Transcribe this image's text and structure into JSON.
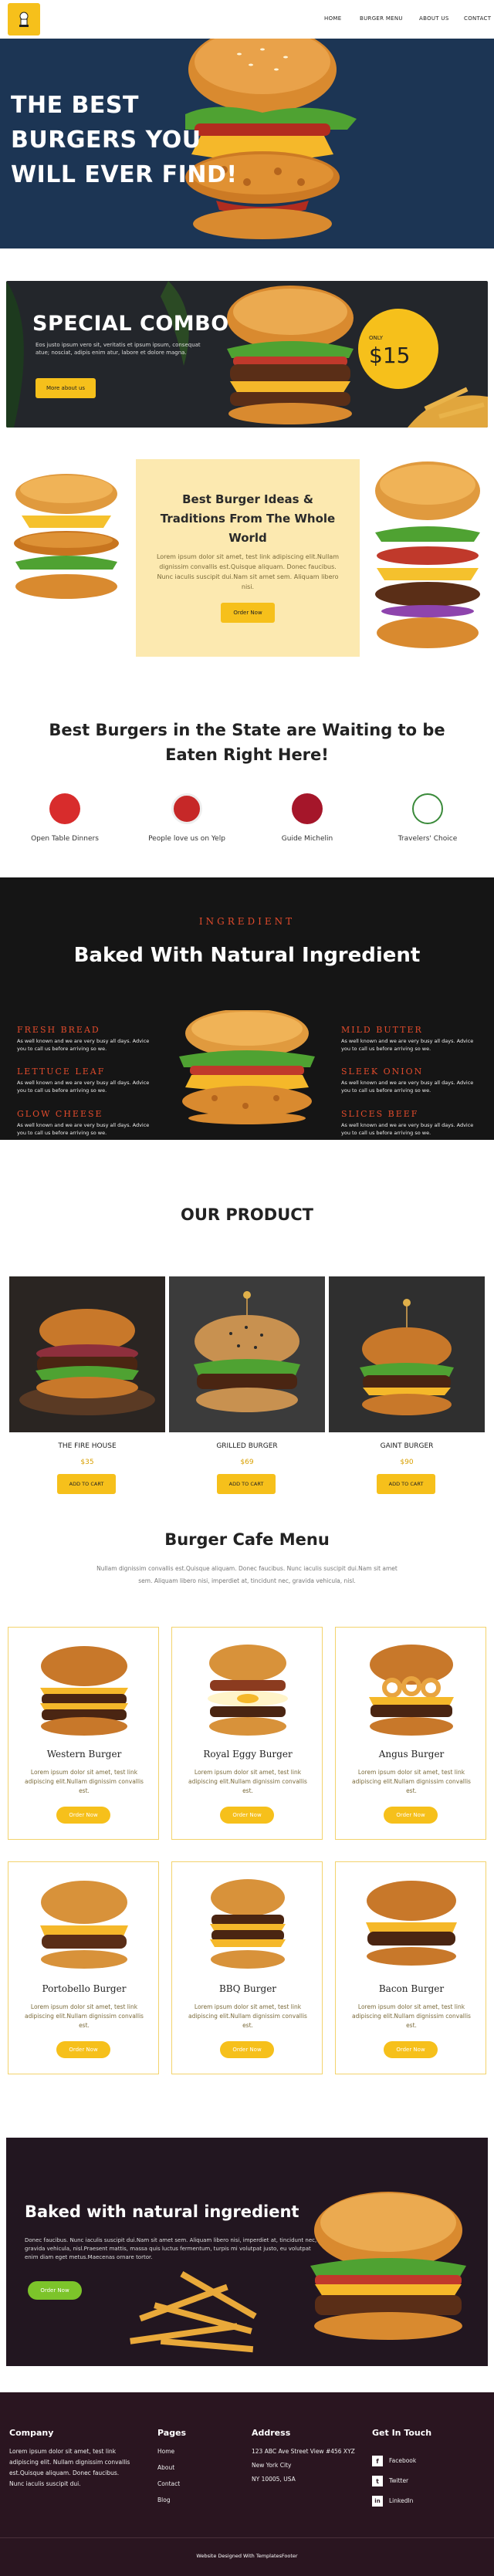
{
  "nav": {
    "links": [
      "HOME",
      "BURGER MENU",
      "ABOUT US",
      "CONTACT"
    ]
  },
  "hero": {
    "title": "THE BEST BURGERS YOU WILL EVER FIND!"
  },
  "combo": {
    "title": "SPECIAL COMBO",
    "text": "Eos justo ipsum vero sit, veritatis et ipsum ipsum, consequat atue; nosciat, adipis enim atur, labore et dolore magna.",
    "button": "More about us",
    "price_label": "ONLY",
    "price": "$15"
  },
  "ideas": {
    "title": "Best Burger Ideas & Traditions From The Whole World",
    "text": "Lorem ipsum dolor sit amet, test link adipiscing elit.Nullam dignissim convallis est.Quisque aliquam. Donec faucibus. Nunc iaculis suscipit dui.Nam sit amet sem. Aliquam libero nisi.",
    "button": "Order Now"
  },
  "awards": {
    "heading": "Best Burgers in the State are Waiting to be Eaten Right Here!",
    "items": [
      "Open Table Dinners",
      "People love us on Yelp",
      "Guide Michelin",
      "Travelers' Choice"
    ]
  },
  "baked": {
    "kicker": "INGREDIENT",
    "title": "Baked With Natural Ingredient",
    "left": [
      {
        "name": "FRESH BREAD",
        "desc": "As well known and we are very busy all days. Advice you to call us before arriving so we."
      },
      {
        "name": "LETTUCE LEAF",
        "desc": "As well known and we are very busy all days. Advice you to call us before arriving so we."
      },
      {
        "name": "GLOW CHEESE",
        "desc": "As well known and we are very busy all days. Advice you to call us before arriving so we."
      }
    ],
    "right": [
      {
        "name": "MILD BUTTER",
        "desc": "As well known and we are very busy all days. Advice you to call us before arriving so we."
      },
      {
        "name": "SLEEK ONION",
        "desc": "As well known and we are very busy all days. Advice you to call us before arriving so we."
      },
      {
        "name": "SLICES BEEF",
        "desc": "As well known and we are very busy all days. Advice you to call us before arriving so we."
      }
    ]
  },
  "products": {
    "heading": "OUR PRODUCT",
    "items": [
      {
        "name": "THE FIRE HOUSE",
        "price": "$35",
        "button": "ADD TO CART"
      },
      {
        "name": "GRILLED BURGER",
        "price": "$69",
        "button": "ADD TO CART"
      },
      {
        "name": "GAINT BURGER",
        "price": "$90",
        "button": "ADD TO CART"
      }
    ]
  },
  "menu": {
    "heading": "Burger Cafe Menu",
    "intro": "Nullam dignissim convallis est.Quisque aliquam. Donec faucibus. Nunc iaculis suscipit dui.Nam sit amet sem. Aliquam libero nisi, imperdiet at, tincidunt nec, gravida vehicula, nisl.",
    "items": [
      {
        "name": "Western Burger",
        "text": "Lorem ipsum dolor sit amet, test link adipiscing elit.Nullam dignissim convallis est.",
        "button": "Order Now"
      },
      {
        "name": "Royal Eggy Burger",
        "text": "Lorem ipsum dolor sit amet, test link adipiscing elit.Nullam dignissim convallis est.",
        "button": "Order Now"
      },
      {
        "name": "Angus Burger",
        "text": "Lorem ipsum dolor sit amet, test link adipiscing elit.Nullam dignissim convallis est.",
        "button": "Order Now"
      },
      {
        "name": "Portobello Burger",
        "text": "Lorem ipsum dolor sit amet, test link adipiscing elit.Nullam dignissim convallis est.",
        "button": "Order Now"
      },
      {
        "name": "BBQ Burger",
        "text": "Lorem ipsum dolor sit amet, test link adipiscing elit.Nullam dignissim convallis est.",
        "button": "Order Now"
      },
      {
        "name": "Bacon Burger",
        "text": "Lorem ipsum dolor sit amet, test link adipiscing elit.Nullam dignissim convallis est.",
        "button": "Order Now"
      }
    ]
  },
  "natural": {
    "title": "Baked with natural ingredient",
    "text": "Donec faucibus. Nunc iaculis suscipit dui.Nam sit amet sem. Aliquam libero nisi, imperdiet at, tincidunt nec, gravida vehicula, nisl.Praesent mattis, massa quis luctus fermentum, turpis mi volutpat justo, eu volutpat enim diam eget metus.Maecenas ornare tortor.",
    "button": "Order Now"
  },
  "footer": {
    "company_heading": "Company",
    "company_text": "Lorem ipsum dolor sit amet, test link adipiscing elit. Nullam dignissim convallis est.Quisque aliquam. Donec faucibus. Nunc iaculis suscipit dui.",
    "pages_heading": "Pages",
    "pages": [
      "Home",
      "About",
      "Contact",
      "Blog"
    ],
    "address_heading": "Address",
    "address": [
      "123 ABC Ave Street View #456 XYZ",
      "New York City",
      "NY 10005, USA"
    ],
    "touch_heading": "Get In Touch",
    "social": [
      {
        "icon": "f",
        "label": "Facebook"
      },
      {
        "icon": "t",
        "label": "Twitter"
      },
      {
        "icon": "in",
        "label": "LinkedIn"
      }
    ],
    "copyright": "Website Designed With TemplatesFooter"
  },
  "colors": {
    "accent": "#f6c01b",
    "hero_bg": "#1c3554",
    "red_text": "#e24b2c",
    "footer_bg": "#2a1520"
  }
}
